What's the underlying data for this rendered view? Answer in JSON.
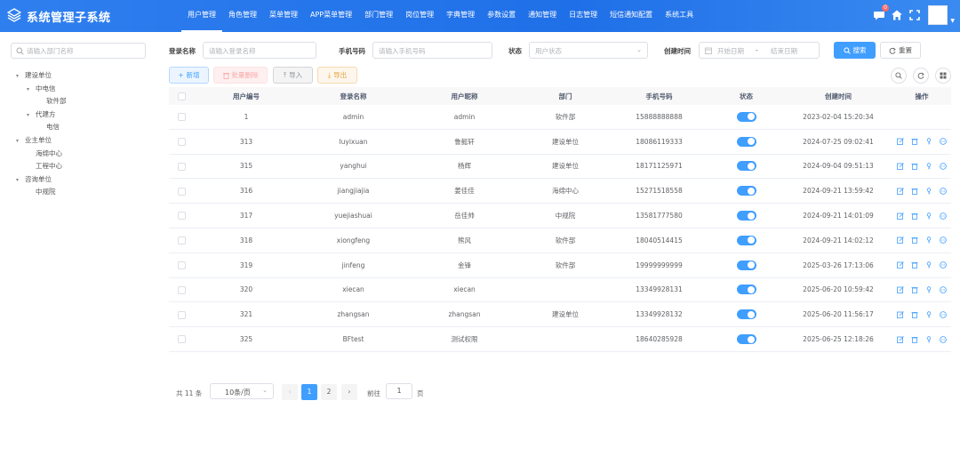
{
  "app": {
    "title": "系统管理子系统"
  },
  "nav": [
    "用户管理",
    "角色管理",
    "菜单管理",
    "APP菜单管理",
    "部门管理",
    "岗位管理",
    "字典管理",
    "参数设置",
    "通知管理",
    "日志管理",
    "短信通知配置",
    "系统工具"
  ],
  "header": {
    "message_badge": "0"
  },
  "dept_search": {
    "placeholder": "请输入部门名称"
  },
  "tree": [
    {
      "label": "建设单位",
      "level": 0,
      "expanded": true
    },
    {
      "label": "中电信",
      "level": 1,
      "expanded": true
    },
    {
      "label": "软件部",
      "level": 2
    },
    {
      "label": "代建方",
      "level": 1,
      "expanded": true
    },
    {
      "label": "电信",
      "level": 2
    },
    {
      "label": "业主单位",
      "level": 0,
      "expanded": true
    },
    {
      "label": "海绵中心",
      "level": 1
    },
    {
      "label": "工程中心",
      "level": 1
    },
    {
      "label": "咨询单位",
      "level": 0,
      "expanded": true
    },
    {
      "label": "中规院",
      "level": 1
    }
  ],
  "form": {
    "login_name_label": "登录名称",
    "login_name_placeholder": "请输入登录名称",
    "phone_label": "手机号码",
    "phone_placeholder": "请输入手机号码",
    "status_label": "状态",
    "status_placeholder": "用户状态",
    "created_label": "创建时间",
    "start_placeholder": "开始日期",
    "range_sep": "-",
    "end_placeholder": "结束日期",
    "search_btn": "搜索",
    "reset_btn": "重置"
  },
  "toolbar": {
    "add": "新增",
    "batch_delete": "批量删除",
    "import": "导入",
    "export": "导出"
  },
  "table": {
    "columns": [
      "用户编号",
      "登录名称",
      "用户昵称",
      "部门",
      "手机号码",
      "状态",
      "创建时间",
      "操作"
    ],
    "rows": [
      {
        "id": "1",
        "login": "admin",
        "nick": "admin",
        "dept": "软件部",
        "phone": "15888888888",
        "enabled": true,
        "created": "2023-02-04 15:20:34",
        "ops": false
      },
      {
        "id": "313",
        "login": "luyixuan",
        "nick": "鲁懿轩",
        "dept": "建设单位",
        "phone": "18086119333",
        "enabled": true,
        "created": "2024-07-25 09:02:41",
        "ops": true
      },
      {
        "id": "315",
        "login": "yanghui",
        "nick": "杨辉",
        "dept": "建设单位",
        "phone": "18171125971",
        "enabled": true,
        "created": "2024-09-04 09:51:13",
        "ops": true
      },
      {
        "id": "316",
        "login": "jiangjiajia",
        "nick": "姜佳佳",
        "dept": "海绵中心",
        "phone": "15271518558",
        "enabled": true,
        "created": "2024-09-21 13:59:42",
        "ops": true
      },
      {
        "id": "317",
        "login": "yuejiashuai",
        "nick": "岳佳帅",
        "dept": "中规院",
        "phone": "13581777580",
        "enabled": true,
        "created": "2024-09-21 14:01:09",
        "ops": true
      },
      {
        "id": "318",
        "login": "xiongfeng",
        "nick": "熊风",
        "dept": "软件部",
        "phone": "18040514415",
        "enabled": true,
        "created": "2024-09-21 14:02:12",
        "ops": true
      },
      {
        "id": "319",
        "login": "jinfeng",
        "nick": "金锋",
        "dept": "软件部",
        "phone": "19999999999",
        "enabled": true,
        "created": "2025-03-26 17:13:06",
        "ops": true
      },
      {
        "id": "320",
        "login": "xiecan",
        "nick": "xiecan",
        "dept": "",
        "phone": "13349928131",
        "enabled": true,
        "created": "2025-06-20 10:59:42",
        "ops": true
      },
      {
        "id": "321",
        "login": "zhangsan",
        "nick": "zhangsan",
        "dept": "建设单位",
        "phone": "13349928132",
        "enabled": true,
        "created": "2025-06-20 11:56:17",
        "ops": true
      },
      {
        "id": "325",
        "login": "BFtest",
        "nick": "测试权限",
        "dept": "",
        "phone": "18640285928",
        "enabled": true,
        "created": "2025-06-25 12:18:26",
        "ops": true
      }
    ]
  },
  "pagination": {
    "total": "共 11 条",
    "page_size": "10条/页",
    "pages": [
      "1",
      "2"
    ],
    "current": "1",
    "goto_label": "前往",
    "goto_value": "1",
    "goto_suffix": "页"
  },
  "colors": {
    "primary": "#409eff",
    "header": "#1f6fe8",
    "danger": "#f56c6c",
    "warning": "#e6a23c"
  }
}
